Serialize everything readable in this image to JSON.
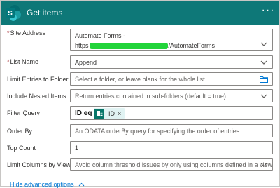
{
  "header": {
    "title": "Get items",
    "more_label": "···",
    "logo_letter": "S",
    "bg_color": "#0e7878"
  },
  "fields": {
    "site_address": {
      "label": "Site Address",
      "required_mark": "*",
      "line1": "Automate Forms -",
      "line2_prefix": "https",
      "line2_suffix": "/AutomateForms"
    },
    "list_name": {
      "label": "List Name",
      "required_mark": "*",
      "value": "Append"
    },
    "limit_entries": {
      "label": "Limit Entries to Folder",
      "placeholder": "Select a folder, or leave blank for the whole list"
    },
    "include_nested": {
      "label": "Include Nested Items",
      "placeholder": "Return entries contained in sub-folders (default = true)"
    },
    "filter_query": {
      "label": "Filter Query",
      "text": "ID eq",
      "token_label": "ID",
      "token_remove": "×"
    },
    "order_by": {
      "label": "Order By",
      "placeholder": "An ODATA orderBy query for specifying the order of entries."
    },
    "top_count": {
      "label": "Top Count",
      "value": "1"
    },
    "limit_columns": {
      "label": "Limit Columns by View",
      "placeholder": "Avoid column threshold issues by only using columns defined in a view"
    }
  },
  "advanced_toggle": "Hide advanced options",
  "colors": {
    "accent": "#0078d4",
    "required": "#a4262c",
    "token_bg": "#e1f3f3"
  }
}
